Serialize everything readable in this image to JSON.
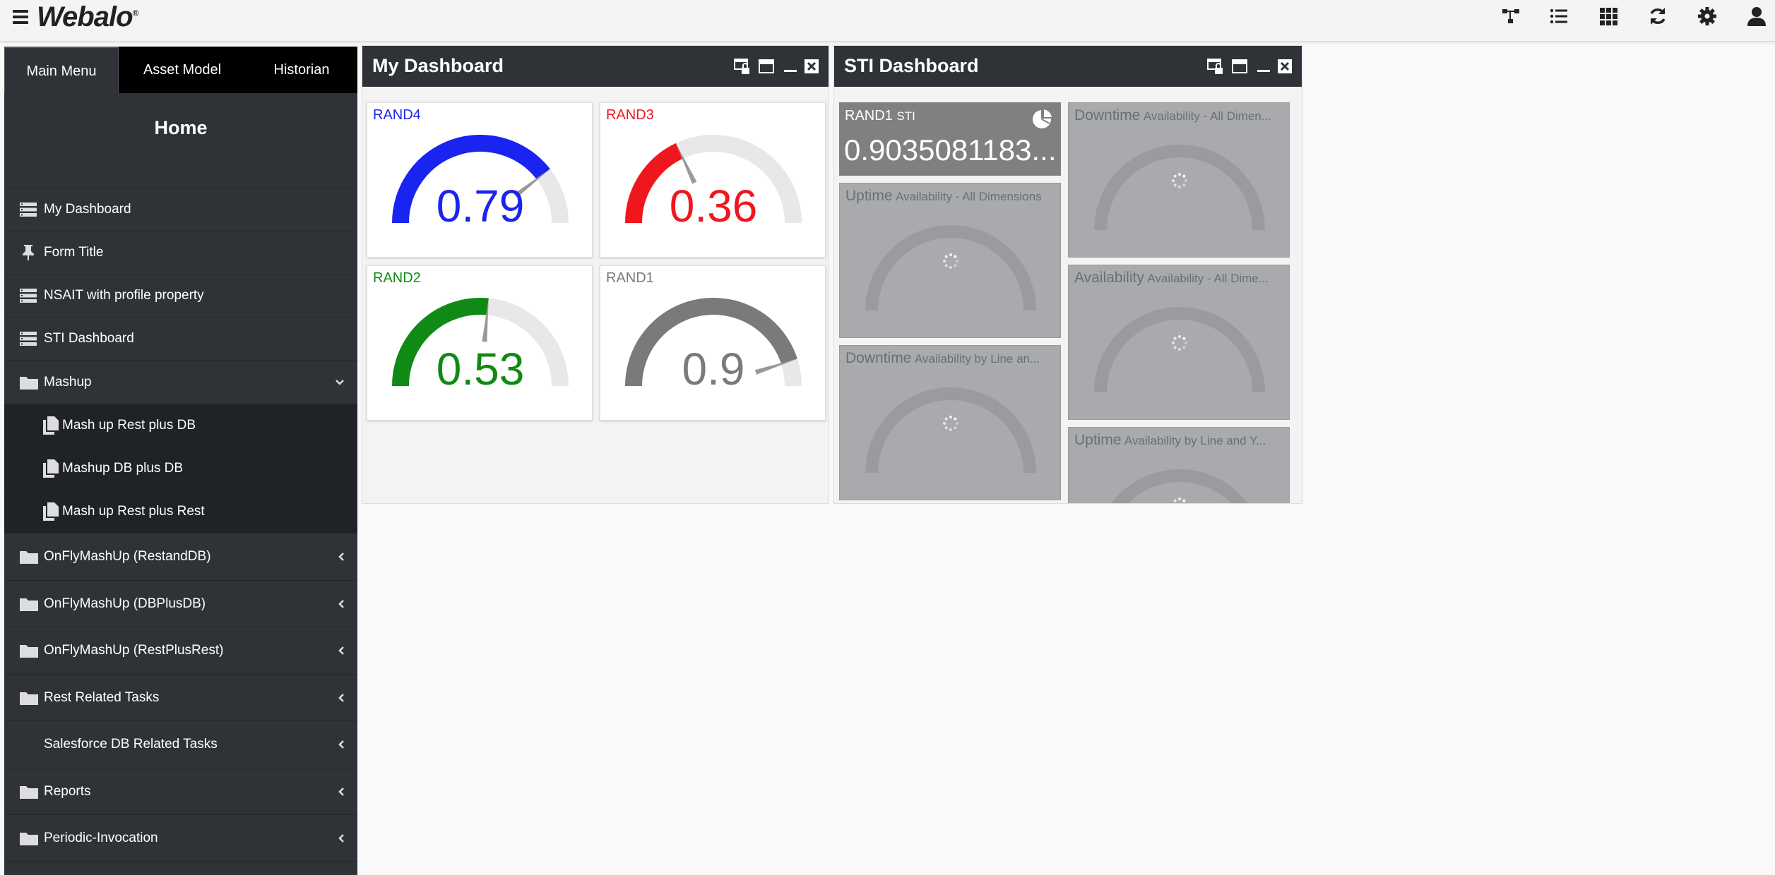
{
  "app": {
    "logo": "Webalo",
    "logo_mark": "®"
  },
  "topbar": {
    "icons": [
      "hierarchy-icon",
      "list-icon",
      "grid-icon",
      "refresh-icon",
      "gear-icon",
      "user-icon"
    ]
  },
  "sidebar": {
    "tabs": [
      {
        "label": "Main Menu",
        "active": true
      },
      {
        "label": "Asset Model",
        "active": false
      },
      {
        "label": "Historian",
        "active": false
      }
    ],
    "title": "Home",
    "items": [
      {
        "label": "My Dashboard",
        "icon": "dashboard-icon"
      },
      {
        "label": "Form Title",
        "icon": "pin-icon"
      },
      {
        "label": "NSAIT with profile property",
        "icon": "dashboard-icon"
      },
      {
        "label": "STI Dashboard",
        "icon": "dashboard-icon"
      },
      {
        "label": "Mashup",
        "icon": "folder-icon",
        "expanded": true
      },
      {
        "label": "Mash up Rest plus DB",
        "icon": "copy-icon",
        "sub": true
      },
      {
        "label": "Mashup DB plus DB",
        "icon": "copy-icon",
        "sub": true
      },
      {
        "label": "Mash up Rest plus Rest",
        "icon": "copy-icon",
        "sub": true
      },
      {
        "label": "OnFlyMashUp (RestandDB)",
        "icon": "folder-icon"
      },
      {
        "label": "OnFlyMashUp (DBPlusDB)",
        "icon": "folder-icon"
      },
      {
        "label": "OnFlyMashUp (RestPlusRest)",
        "icon": "folder-icon"
      },
      {
        "label": "Rest Related Tasks",
        "icon": "folder-icon"
      },
      {
        "label": "Salesforce DB Related Tasks",
        "icon": "none"
      },
      {
        "label": "Reports",
        "icon": "folder-icon"
      },
      {
        "label": "Periodic-Invocation",
        "icon": "folder-icon"
      }
    ]
  },
  "my_dashboard": {
    "title": "My Dashboard",
    "gauges": [
      {
        "label": "RAND4",
        "value_text": "0.79",
        "value": 0.79,
        "color": "#1a24f0"
      },
      {
        "label": "RAND3",
        "value_text": "0.36",
        "value": 0.36,
        "color": "#f0161e"
      },
      {
        "label": "RAND2",
        "value_text": "0.53",
        "value": 0.53,
        "color": "#0f8a14"
      },
      {
        "label": "RAND1",
        "value_text": "0.9",
        "value": 0.9,
        "color": "#7a7a7a"
      }
    ]
  },
  "sti_dashboard": {
    "title": "STI Dashboard",
    "sti_card": {
      "label": "RAND1",
      "sublabel": "STI",
      "value": "0.9035081183..."
    },
    "cards": [
      {
        "title_big": "Uptime",
        "title_small": "Availability - All Dimensions"
      },
      {
        "title_big": "Downtime",
        "title_small": "Availability by Line an..."
      },
      {
        "title_big": "Downtime",
        "title_small": "Availability - All Dimen..."
      },
      {
        "title_big": "Availability",
        "title_small": "Availability - All Dime..."
      },
      {
        "title_big": "Uptime",
        "title_small": "Availability by Line and Y..."
      }
    ]
  }
}
